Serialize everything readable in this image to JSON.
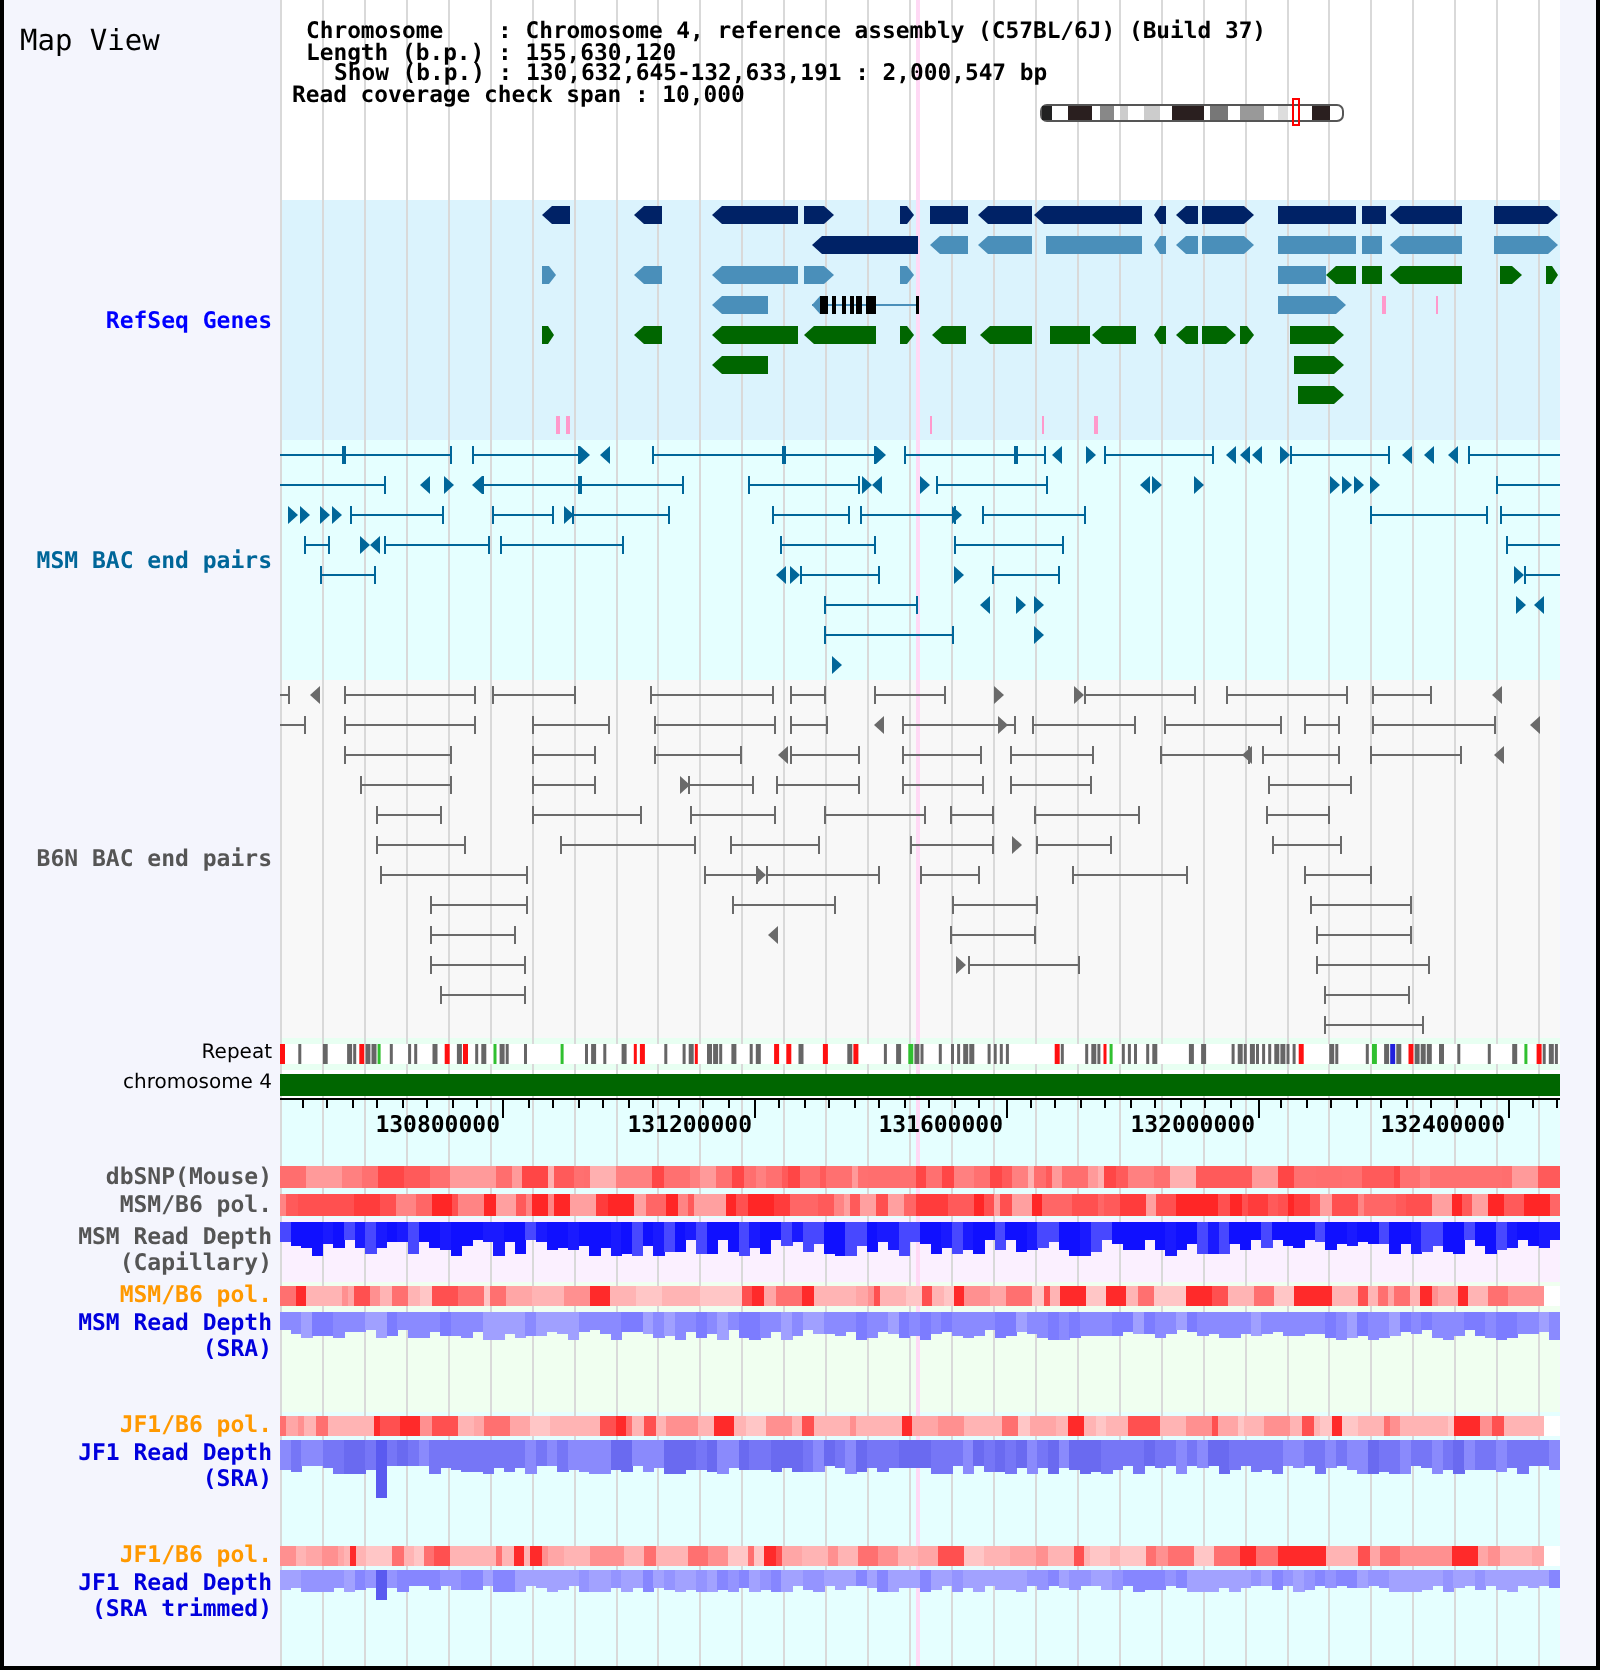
{
  "title": "Map View",
  "summary": [
    "Chromosome    : Chromosome 4, reference assembly (C57BL/6J) (Build 37)",
    "Length (b.p.) : 155,630,120",
    "Show (b.p.) : 130,632,645-132,633,191 : 2,000,547 bp",
    "Read coverage check span : 10,000"
  ],
  "tracks": [
    {
      "kind": "genes",
      "label": "RefSeq Genes",
      "color": "#0000ff"
    },
    {
      "kind": "pairs",
      "label": "MSM BAC end pairs",
      "color": "#006699"
    },
    {
      "kind": "pairs",
      "label": "B6N BAC end pairs",
      "color": "#555555"
    },
    {
      "kind": "repeat",
      "label": "Repeat",
      "color": "#000000"
    },
    {
      "kind": "chromosome",
      "label": "chromosome 4",
      "color": "#000000"
    },
    {
      "kind": "axis",
      "ticks": [
        "130800000",
        "131200000",
        "131600000",
        "132000000",
        "132400000"
      ]
    },
    {
      "kind": "heatmap",
      "label": "dbSNP(Mouse)",
      "color": "#555555"
    },
    {
      "kind": "heatmap",
      "label": "MSM/B6 pol.",
      "color": "#555555"
    },
    {
      "kind": "depth",
      "label": "MSM Read Depth (Capillary)",
      "color": "#555555"
    },
    {
      "kind": "heatmap",
      "label": "MSM/B6 pol.",
      "color": "#ff9900"
    },
    {
      "kind": "depth",
      "label": "MSM Read Depth (SRA)",
      "color": "#0000dd"
    },
    {
      "kind": "heatmap",
      "label": "JF1/B6 pol.",
      "color": "#ff9900"
    },
    {
      "kind": "depth",
      "label": "JF1 Read Depth (SRA)",
      "color": "#0000dd"
    },
    {
      "kind": "heatmap",
      "label": "JF1/B6 pol.",
      "color": "#ff9900"
    },
    {
      "kind": "depth",
      "label": "JF1 Read Depth (SRA trimmed)",
      "color": "#0000dd"
    }
  ]
}
